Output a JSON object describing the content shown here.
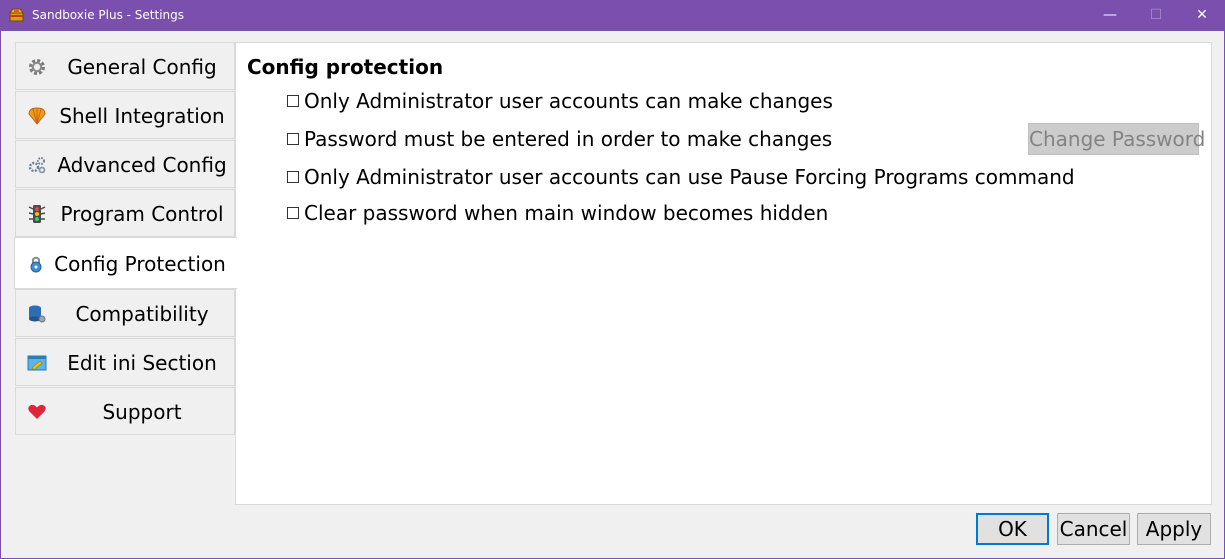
{
  "window": {
    "title": "Sandboxie Plus - Settings",
    "controls": {
      "minimize": "—",
      "maximize": "☐",
      "close": "✕"
    },
    "accent_color": "#7a4fae"
  },
  "tabs": [
    {
      "label": "General Config",
      "icon": "gear-icon"
    },
    {
      "label": "Shell Integration",
      "icon": "shell-icon"
    },
    {
      "label": "Advanced Config",
      "icon": "gears-icon"
    },
    {
      "label": "Program Control",
      "icon": "traffic-light-icon"
    },
    {
      "label": "Config Protection",
      "icon": "lock-icon",
      "selected": true
    },
    {
      "label": "Compatibility",
      "icon": "database-gear-icon"
    },
    {
      "label": "Edit ini Section",
      "icon": "edit-window-icon"
    },
    {
      "label": "Support",
      "icon": "heart-icon"
    }
  ],
  "page": {
    "title": "Config protection",
    "options": [
      {
        "label": "Only Administrator user accounts can make changes",
        "checked": false
      },
      {
        "label": "Password must be entered in order to make changes",
        "checked": false
      },
      {
        "label": "Only Administrator user accounts can use Pause Forcing Programs command",
        "checked": false
      },
      {
        "label": "Clear password when main window becomes hidden",
        "checked": false
      }
    ],
    "change_password_label": "Change Password",
    "change_password_enabled": false
  },
  "buttons": {
    "ok": "OK",
    "cancel": "Cancel",
    "apply": "Apply"
  }
}
